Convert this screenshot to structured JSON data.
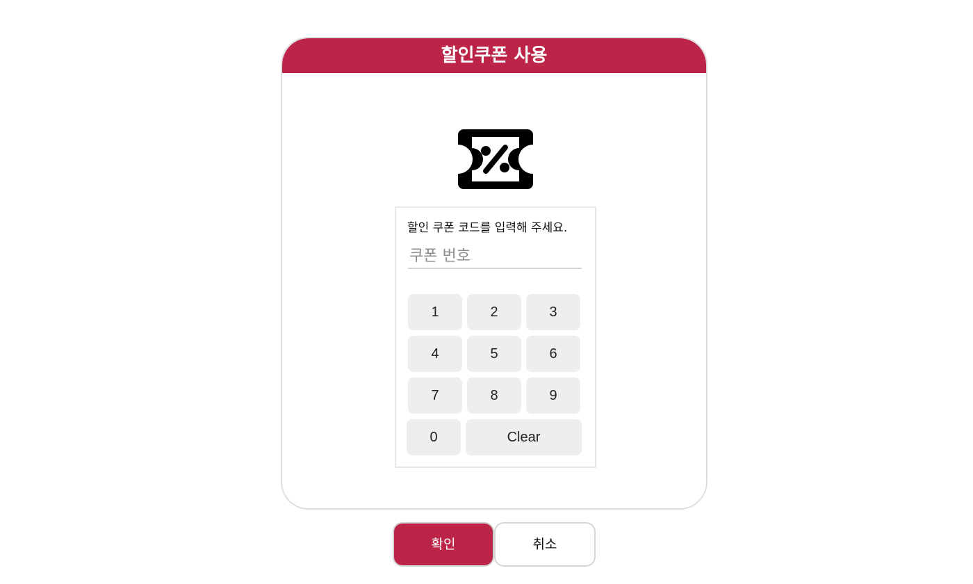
{
  "dialog": {
    "title": "할인쿠폰 사용",
    "icon": "discount-coupon-icon",
    "accent_color": "#bd2548"
  },
  "coupon_form": {
    "prompt": "할인 쿠폰 코드를 입력해 주세요.",
    "input_value": "",
    "input_placeholder": "쿠폰 번호"
  },
  "keypad": {
    "keys": [
      "1",
      "2",
      "3",
      "4",
      "5",
      "6",
      "7",
      "8",
      "9",
      "0"
    ],
    "clear_label": "Clear"
  },
  "actions": {
    "confirm_label": "확인",
    "cancel_label": "취소"
  }
}
